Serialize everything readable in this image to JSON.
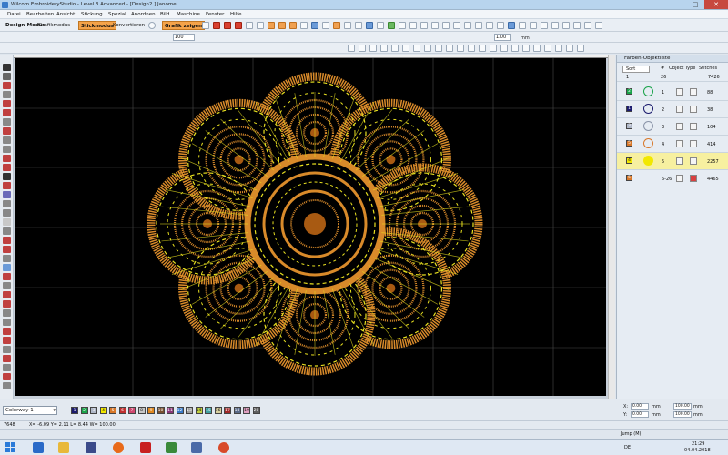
{
  "window": {
    "title": "Wilcom EmbroideryStudio - Level 3 Advanced - [Design2 ] Janome"
  },
  "menu": [
    "Datei",
    "Bearbeiten",
    "Ansicht",
    "Stickung",
    "Spezial",
    "Anordnen",
    "Bild",
    "Maschine",
    "Fenster",
    "Hilfe"
  ],
  "modes": {
    "design": "Design-Modus",
    "grafik": "Grafikmodus",
    "stick": "Stickmodus",
    "konvert": "Konvertieren",
    "show_graphic": "Grafik zeigen"
  },
  "toolbar": {
    "zoom_value": "100",
    "stitch_length": "1.00",
    "stitch_unit": "mm"
  },
  "colors_panel": {
    "title": "Farben-Objektliste",
    "header": {
      "count_label": "Sort",
      "hash": "#",
      "object_type": "Object Type",
      "stitches": "Stitches"
    },
    "summary": {
      "col1": "1",
      "col2": "26",
      "total": "7426"
    },
    "rows": [
      {
        "swatch_num": "2",
        "swatch_color": "#1aa34a",
        "circle_color": "#1aa34a",
        "num": "1",
        "stitches": "88"
      },
      {
        "swatch_num": "1",
        "swatch_color": "#1c1c6e",
        "circle_color": "#1c1c6e",
        "num": "2",
        "stitches": "38"
      },
      {
        "swatch_num": "3",
        "swatch_color": "#b0b8c8",
        "circle_color": "#8a94a8",
        "num": "3",
        "stitches": "104"
      },
      {
        "swatch_num": "5",
        "swatch_color": "#d8782a",
        "circle_color": "#d8782a",
        "num": "4",
        "stitches": "414"
      },
      {
        "swatch_num": "4",
        "swatch_color": "#f2e800",
        "circle_color": "#f2e800",
        "num": "5",
        "stitches": "2257"
      },
      {
        "swatch_num": "5",
        "swatch_color": "#d8782a",
        "circle_color": "#d8782a",
        "num": "6-26",
        "stitches": "4465"
      }
    ]
  },
  "colorway": {
    "name": "Colorway 1"
  },
  "palette": [
    {
      "n": "1",
      "c": "#1c1c6e"
    },
    {
      "n": "2",
      "c": "#1aa34a"
    },
    {
      "n": "3",
      "c": "#b0b8c8"
    },
    {
      "n": "4",
      "c": "#f2e800"
    },
    {
      "n": "5",
      "c": "#d8782a"
    },
    {
      "n": "6",
      "c": "#c03030"
    },
    {
      "n": "7",
      "c": "#d04870"
    },
    {
      "n": "8",
      "c": "#c8c8c8"
    },
    {
      "n": "9",
      "c": "#e08820"
    },
    {
      "n": "10",
      "c": "#7a5030"
    },
    {
      "n": "11",
      "c": "#8a3878"
    },
    {
      "n": "12",
      "c": "#3a7ac8"
    },
    {
      "n": "13",
      "c": "#a0a0a0"
    },
    {
      "n": "14",
      "c": "#c0d040"
    },
    {
      "n": "15",
      "c": "#40a0a0"
    },
    {
      "n": "16",
      "c": "#d8d0a0"
    },
    {
      "n": "17",
      "c": "#a02828"
    },
    {
      "n": "18",
      "c": "#5a6a88"
    },
    {
      "n": "19",
      "c": "#e0a0c0"
    },
    {
      "n": "20",
      "c": "#606060"
    }
  ],
  "position": {
    "x_label": "X:",
    "x": "0.00",
    "y_label": "Y:",
    "y": "0.00",
    "w": "0.00",
    "h": "0.00",
    "pct1": "100.00",
    "pct2": "100.00",
    "unit": "mm"
  },
  "status": {
    "stitches": "7648",
    "coords": "X= -6.09 Y= 2.11 L= 8.44 W= 100.00",
    "jump": "Jump (M)"
  },
  "taskbar": {
    "lang": "DE",
    "time": "21:29",
    "date": "04.04.2018"
  }
}
